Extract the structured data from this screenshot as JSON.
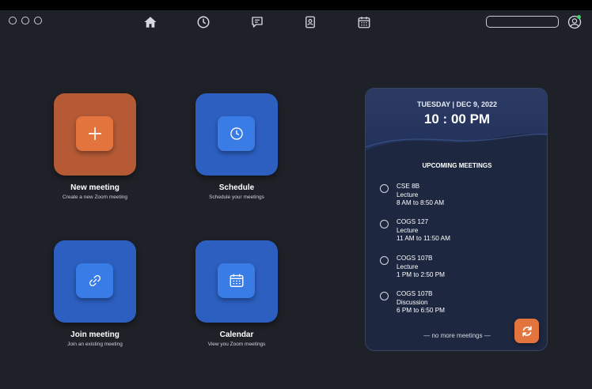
{
  "nav": {
    "icons": [
      "home-icon",
      "clock-icon",
      "chat-icon",
      "contacts-icon",
      "calendar-icon"
    ],
    "search_placeholder": ""
  },
  "tiles": {
    "new_meeting": {
      "title": "New meeting",
      "subtitle": "Create a new Zoom meeting"
    },
    "schedule": {
      "title": "Schedule",
      "subtitle": "Schedule your meetings"
    },
    "join_meeting": {
      "title": "Join meeting",
      "subtitle": "Join an existing meeting"
    },
    "calendar": {
      "title": "Calendar",
      "subtitle": "View you Zoom meetings"
    }
  },
  "panel": {
    "date": "TUESDAY | DEC 9, 2022",
    "time": "10 : 00 PM",
    "upcoming_title": "UPCOMING MEETINGS",
    "meetings": [
      {
        "course": "CSE 8B",
        "type": "Lecture",
        "time": "8 AM to 8:50 AM"
      },
      {
        "course": "COGS 127",
        "type": "Lecture",
        "time": "11 AM to 11:50 AM"
      },
      {
        "course": "COGS 107B",
        "type": "Lecture",
        "time": "1 PM to 2:50 PM"
      },
      {
        "course": "COGS 107B",
        "type": "Discussion",
        "time": "6 PM to 6:50 PM"
      }
    ],
    "footer": "— no more meetings —"
  },
  "colors": {
    "background": "#1f2128",
    "tile_blue": "#2c5fc0",
    "tile_orange": "#b55a35",
    "accent_orange": "#e4743e",
    "panel": "#1d2740",
    "online": "#3fd26a"
  }
}
